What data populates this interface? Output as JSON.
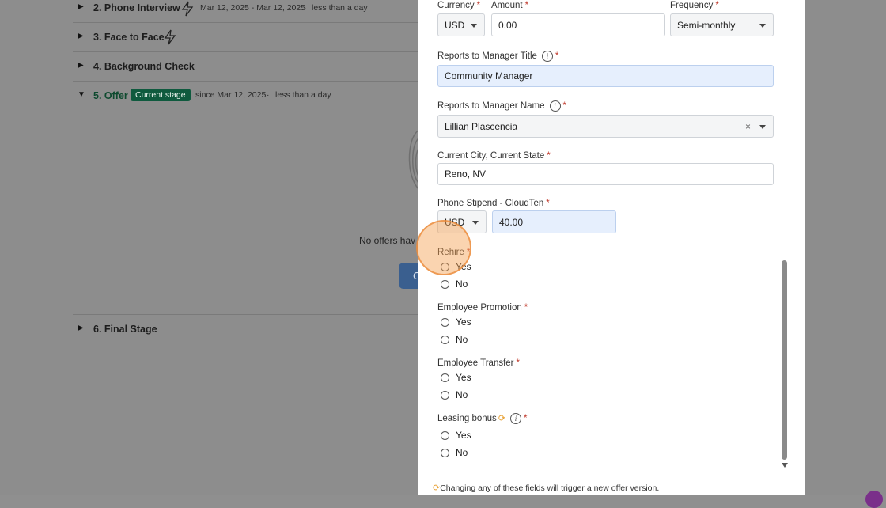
{
  "stages": [
    {
      "number_label": "2. Phone Interview",
      "dates": "Mar 12, 2025 - Mar 12, 2025",
      "duration": "less than a day"
    },
    {
      "number_label": "3. Face to Face"
    },
    {
      "number_label": "4. Background Check"
    },
    {
      "number_label": "5. Offer",
      "badge": "Current stage",
      "since": "since Mar 12, 2025",
      "duration": "less than a day"
    },
    {
      "number_label": "6. Final Stage"
    }
  ],
  "offer_empty": {
    "text": "No offers hav",
    "button": "C"
  },
  "form": {
    "currency_label": "Currency",
    "currency_value": "USD",
    "amount_label": "Amount",
    "amount_value": "0.00",
    "frequency_label": "Frequency",
    "frequency_value": "Semi-monthly",
    "rtm_title_label": "Reports to Manager Title",
    "rtm_title_value": "Community Manager",
    "rtm_name_label": "Reports to Manager Name",
    "rtm_name_value": "Lillian Plascencia",
    "city_label": "Current City, Current State",
    "city_value": "Reno, NV",
    "stipend_label": "Phone Stipend - CloudTen",
    "stipend_currency": "USD",
    "stipend_value": "40.00",
    "rehire_label": "Rehire",
    "promotion_label": "Employee Promotion",
    "transfer_label": "Employee Transfer",
    "leasing_label": "Leasing bonus",
    "yes": "Yes",
    "no": "No",
    "required_mark": "*",
    "info_glyph": "i",
    "clear_glyph": "×",
    "sync_glyph": "⟳"
  },
  "footnote": "Changing any of these fields will trigger a new offer version."
}
